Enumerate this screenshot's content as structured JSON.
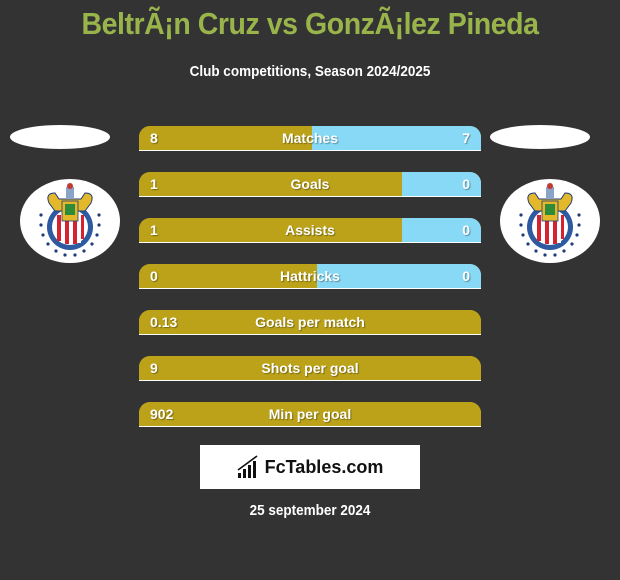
{
  "header": {
    "title": "BeltrÃ¡n Cruz vs GonzÃ¡lez Pineda",
    "subtitle": "Club competitions, Season 2024/2025"
  },
  "players": {
    "left": {
      "crest_icon": "chivas-crest-icon"
    },
    "right": {
      "crest_icon": "chivas-crest-icon"
    }
  },
  "colors": {
    "background": "#333333",
    "title": "#99b44a",
    "left_bar": "#bba219",
    "right_bar": "#87d9f5"
  },
  "stats": [
    {
      "label": "Matches",
      "left": "8",
      "right": "7",
      "left_share": 0.505
    },
    {
      "label": "Goals",
      "left": "1",
      "right": "0",
      "left_share": 0.77
    },
    {
      "label": "Assists",
      "left": "1",
      "right": "0",
      "left_share": 0.77
    },
    {
      "label": "Hattricks",
      "left": "0",
      "right": "0",
      "left_share": 0.52
    },
    {
      "label": "Goals per match",
      "left": "0.13",
      "right": "",
      "left_share": 1
    },
    {
      "label": "Shots per goal",
      "left": "9",
      "right": "",
      "left_share": 1
    },
    {
      "label": "Min per goal",
      "left": "902",
      "right": "",
      "left_share": 1
    }
  ],
  "logo": {
    "text": "FcTables.com",
    "icon": "bar-chart-icon"
  },
  "footer": {
    "date": "25 september 2024"
  }
}
